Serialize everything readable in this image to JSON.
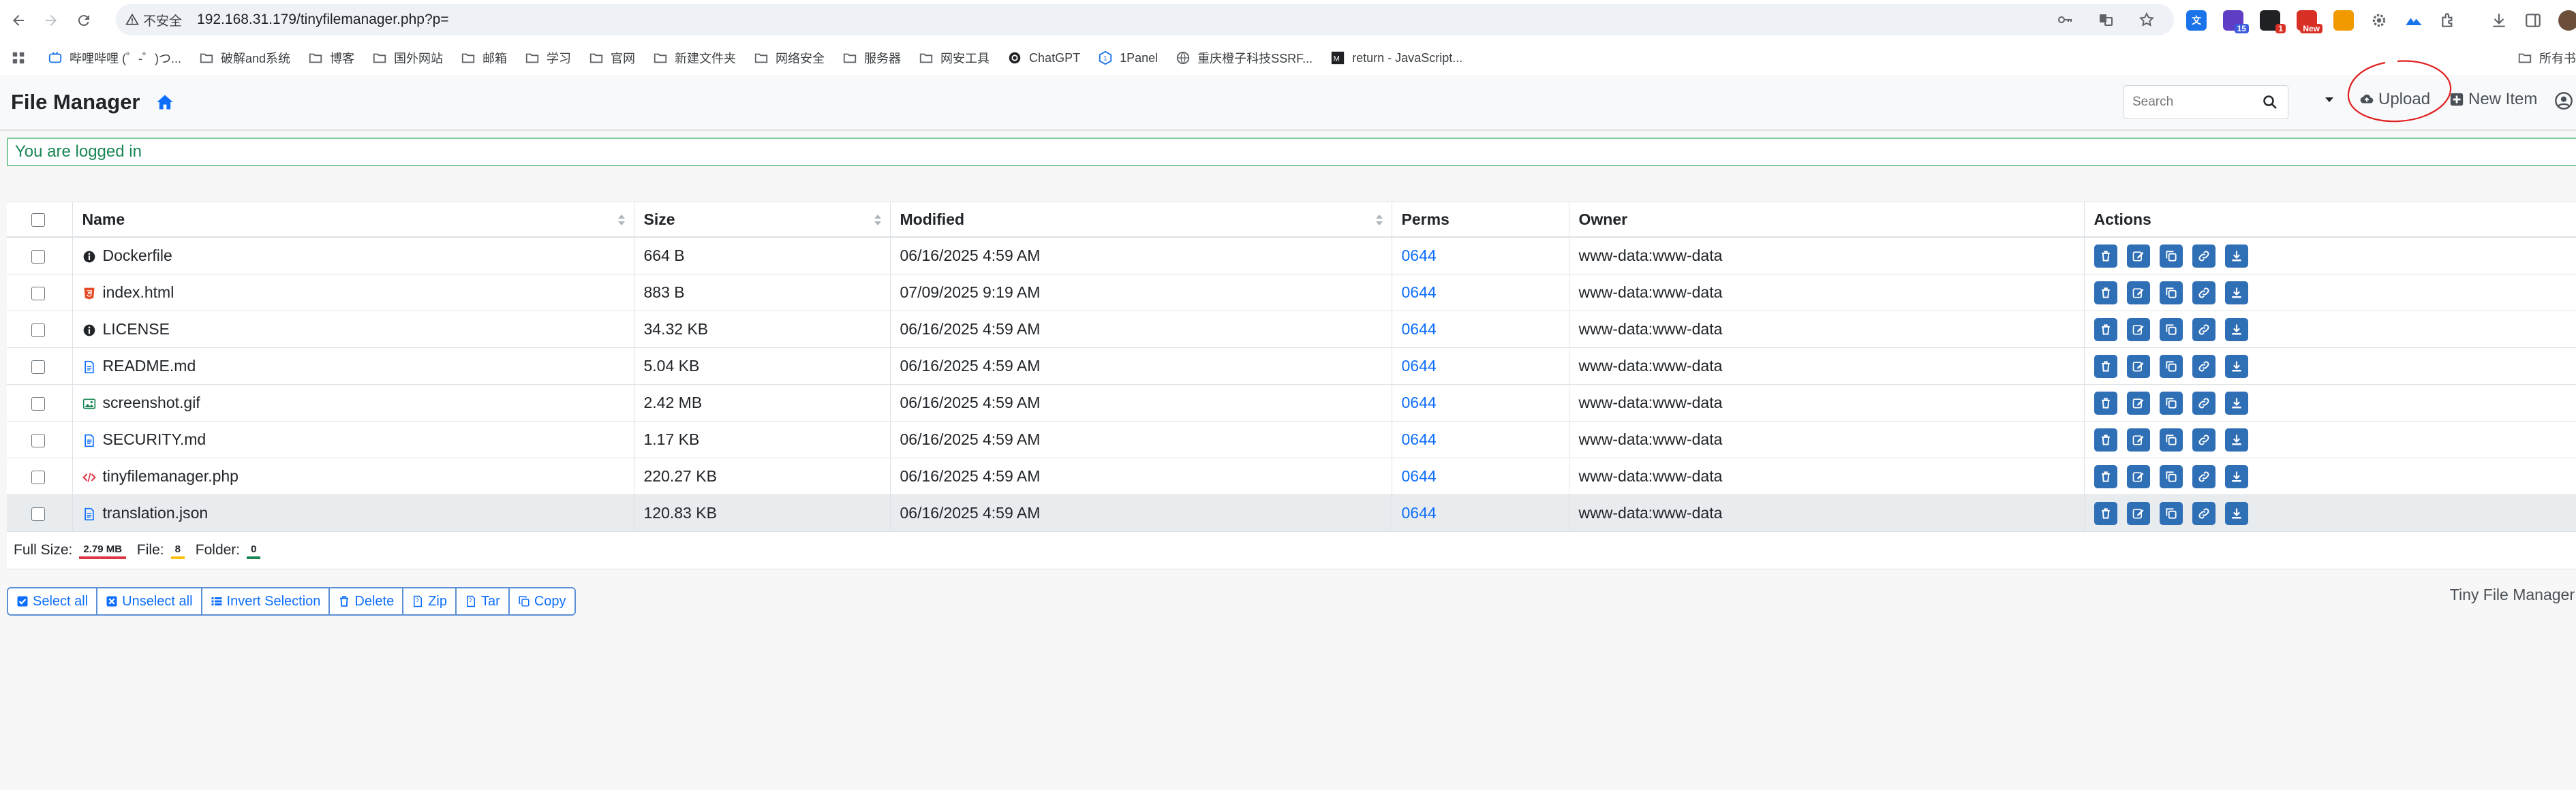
{
  "browser": {
    "security_label": "不安全",
    "url": "192.168.31.179/tinyfilemanager.php?p=",
    "extensions": [
      {
        "name": "translate-ext-icon",
        "color": "#1a73e8",
        "badge": ""
      },
      {
        "name": "ext-15-icon",
        "color": "#5f3dc4",
        "badge": "15"
      },
      {
        "name": "ext-1-icon",
        "color": "#202124",
        "badge": "1"
      },
      {
        "name": "ext-new-icon",
        "color": "#d93025",
        "badge": "New"
      }
    ]
  },
  "bookmarks": [
    "哔哩哔哩 (゜-゜)つ...",
    "破解and系统",
    "博客",
    "国外网站",
    "邮箱",
    "学习",
    "官网",
    "新建文件夹",
    "网络安全",
    "服务器",
    "网安工具",
    "ChatGPT",
    "1Panel",
    "重庆橙子科技SSRF...",
    "return - JavaScript..."
  ],
  "bookmarks_right": "所有书",
  "header": {
    "title": "File Manager",
    "search_placeholder": "Search",
    "upload_label": "Upload",
    "new_item_label": "New Item"
  },
  "alert": "You are logged in",
  "table": {
    "columns": [
      "Name",
      "Size",
      "Modified",
      "Perms",
      "Owner",
      "Actions"
    ],
    "rows": [
      {
        "name": "Dockerfile",
        "icon": "info-icon",
        "size": "664 B",
        "modified": "06/16/2025 4:59 AM",
        "perms": "0644",
        "owner": "www-data:www-data"
      },
      {
        "name": "index.html",
        "icon": "html5-icon",
        "size": "883 B",
        "modified": "07/09/2025 9:19 AM",
        "perms": "0644",
        "owner": "www-data:www-data"
      },
      {
        "name": "LICENSE",
        "icon": "info-icon",
        "size": "34.32 KB",
        "modified": "06/16/2025 4:59 AM",
        "perms": "0644",
        "owner": "www-data:www-data"
      },
      {
        "name": "README.md",
        "icon": "file-text-icon",
        "size": "5.04 KB",
        "modified": "06/16/2025 4:59 AM",
        "perms": "0644",
        "owner": "www-data:www-data"
      },
      {
        "name": "screenshot.gif",
        "icon": "image-icon",
        "size": "2.42 MB",
        "modified": "06/16/2025 4:59 AM",
        "perms": "0644",
        "owner": "www-data:www-data"
      },
      {
        "name": "SECURITY.md",
        "icon": "file-text-icon",
        "size": "1.17 KB",
        "modified": "06/16/2025 4:59 AM",
        "perms": "0644",
        "owner": "www-data:www-data"
      },
      {
        "name": "tinyfilemanager.php",
        "icon": "code-icon",
        "size": "220.27 KB",
        "modified": "06/16/2025 4:59 AM",
        "perms": "0644",
        "owner": "www-data:www-data"
      },
      {
        "name": "translation.json",
        "icon": "file-text-icon",
        "size": "120.83 KB",
        "modified": "06/16/2025 4:59 AM",
        "perms": "0644",
        "owner": "www-data:www-data"
      }
    ],
    "actions": [
      "delete-icon",
      "edit-icon",
      "copy-icon",
      "link-icon",
      "download-icon"
    ]
  },
  "summary": {
    "full_size_label": "Full Size:",
    "full_size_value": "2.79 MB",
    "file_label": "File:",
    "file_value": "8",
    "folder_label": "Folder:",
    "folder_value": "0"
  },
  "bulk_actions": [
    "Select all",
    "Unselect all",
    "Invert Selection",
    "Delete",
    "Zip",
    "Tar",
    "Copy"
  ],
  "footer_brand": "Tiny File Manager",
  "colors": {
    "accent": "#0d6efd",
    "action_button": "#2f6fb6",
    "alert_text": "#198754",
    "annotation_circle": "#e02020"
  }
}
